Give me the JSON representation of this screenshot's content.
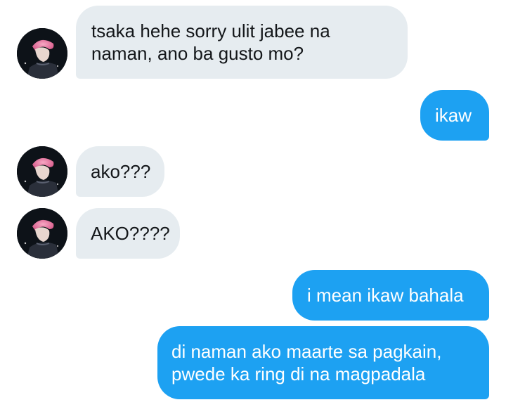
{
  "conversation": {
    "messages": [
      {
        "sender": "them",
        "text": "tsaka hehe sorry ulit jabee na\nnaman, ano ba gusto mo?"
      },
      {
        "sender": "me",
        "text": "ikaw"
      },
      {
        "sender": "them",
        "text": "ako???"
      },
      {
        "sender": "them",
        "text": "AKO????"
      },
      {
        "sender": "me",
        "text": "i mean ikaw bahala"
      },
      {
        "sender": "me",
        "text": "di naman ako maarte sa pagkain,\npwede ka ring di na magpadala"
      }
    ]
  },
  "colors": {
    "incoming_bubble": "#e6ecf0",
    "outgoing_bubble": "#1da1f2",
    "incoming_text": "#14171a",
    "outgoing_text": "#ffffff"
  },
  "icons": {
    "avatar": "contact-avatar-photo"
  }
}
